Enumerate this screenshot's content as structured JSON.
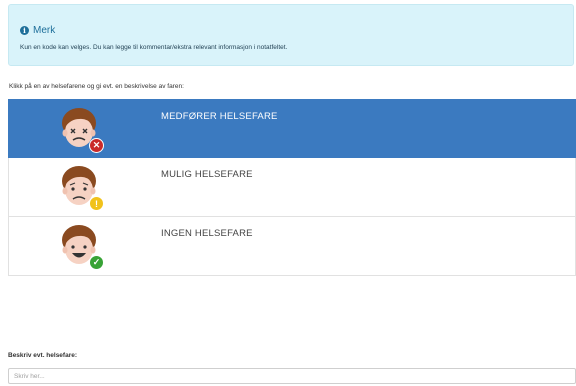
{
  "notice": {
    "title": "Merk",
    "text": "Kun en kode kan velges. Du kan legge til kommentar/ekstra relevant informasjon i notatfeltet.",
    "icon": "info-icon"
  },
  "instruction": "Klikk på en av helsefarene og gi evt. en beskrivelse av faren:",
  "options": [
    {
      "label": "MEDFØRER HELSEFARE",
      "selected": true,
      "badge_icon": "x-circle-icon",
      "face": "dizzy-face-icon"
    },
    {
      "label": "MULIG HELSEFARE",
      "selected": false,
      "badge_icon": "exclamation-circle-icon",
      "face": "worried-face-icon"
    },
    {
      "label": "INGEN HELSEFARE",
      "selected": false,
      "badge_icon": "check-circle-icon",
      "face": "happy-face-icon"
    }
  ],
  "description": {
    "label": "Beskriv evt. helsefare:",
    "placeholder": "Skriv her..."
  },
  "colors": {
    "selected_bg": "#3b7ac0",
    "notice_bg": "#d9f3fa",
    "danger": "#c92a2a",
    "warning": "#f1c21b",
    "ok": "#38a336"
  }
}
